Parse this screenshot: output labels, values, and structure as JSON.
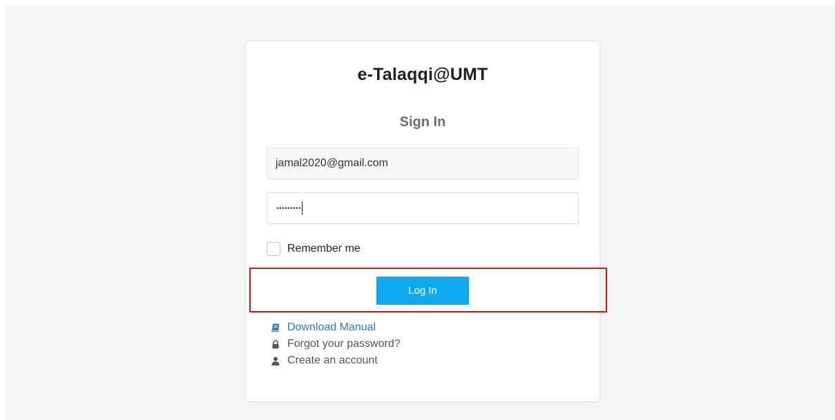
{
  "app": {
    "title": "e-Talaqqi@UMT"
  },
  "form": {
    "heading": "Sign In",
    "email_value": "jamal2020@gmail.com",
    "password_masked": "•••••••••",
    "remember_label": "Remember me",
    "remember_checked": false,
    "login_label": "Log In"
  },
  "links": {
    "manual_label": "Download Manual",
    "forgot_label": "Forgot your password?",
    "create_label": "Create an account"
  },
  "icons": {
    "manual": "book-icon",
    "forgot": "lock-icon",
    "create": "user-icon"
  },
  "colors": {
    "primary_button": "#10aaf0",
    "link": "#2a7bbf",
    "highlight": "#e0101a",
    "background": "#f4f4f5"
  }
}
